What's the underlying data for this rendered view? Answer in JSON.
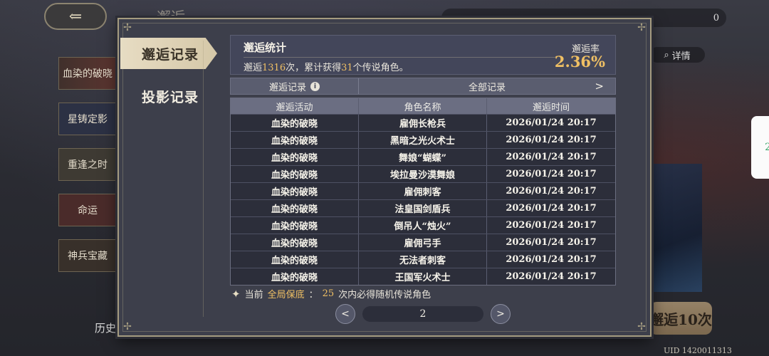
{
  "background": {
    "title": "邂逅",
    "top_value": "0",
    "banners": [
      "血染的破晓",
      "星铸定影",
      "重逢之时",
      "命运",
      "神兵宝藏"
    ],
    "history_label": "历史",
    "detail_label": "详情",
    "draw_ten_label": "邂逅10次",
    "uid": "UID 1420011313",
    "side_popup_text": "2"
  },
  "sidebar": {
    "tabs": [
      {
        "label": "邂逅记录",
        "active": true
      },
      {
        "label": "投影记录",
        "active": false
      }
    ]
  },
  "stats": {
    "title": "邂逅统计",
    "text_prefix": "邂逅",
    "total_draws": "1316",
    "text_mid": "次，累计获得",
    "legendary_count": "31",
    "text_suffix": "个传说角色。",
    "rate_label": "邂逅率",
    "rate_value": "2.36%"
  },
  "selector": {
    "left_label": "邂逅记录",
    "right_label": "全部记录"
  },
  "table": {
    "headers": [
      "邂逅活动",
      "角色名称",
      "邂逅时间"
    ],
    "rows": [
      [
        "血染的破晓",
        "雇佣长枪兵",
        "2026/01/24 20:17"
      ],
      [
        "血染的破晓",
        "黑暗之光火术士",
        "2026/01/24 20:17"
      ],
      [
        "血染的破晓",
        "舞娘“蝴蝶”",
        "2026/01/24 20:17"
      ],
      [
        "血染的破晓",
        "埃拉曼沙漠舞娘",
        "2026/01/24 20:17"
      ],
      [
        "血染的破晓",
        "雇佣刺客",
        "2026/01/24 20:17"
      ],
      [
        "血染的破晓",
        "法皇国剑盾兵",
        "2026/01/24 20:17"
      ],
      [
        "血染的破晓",
        "倒吊人“烛火”",
        "2026/01/24 20:17"
      ],
      [
        "血染的破晓",
        "雇佣弓手",
        "2026/01/24 20:17"
      ],
      [
        "血染的破晓",
        "无法者刺客",
        "2026/01/24 20:17"
      ],
      [
        "血染的破晓",
        "王国军火术士",
        "2026/01/24 20:17"
      ]
    ]
  },
  "guarantee": {
    "prefix": "当前",
    "highlight": "全局保底",
    "colon": "：",
    "count": "25",
    "suffix": "次内必得随机传说角色"
  },
  "pager": {
    "current_page": "2"
  },
  "colors": {
    "accent_gold": "#f0c064",
    "modal_bg": "#3d3f4b",
    "active_tab_bg": "#e7dcc3"
  }
}
